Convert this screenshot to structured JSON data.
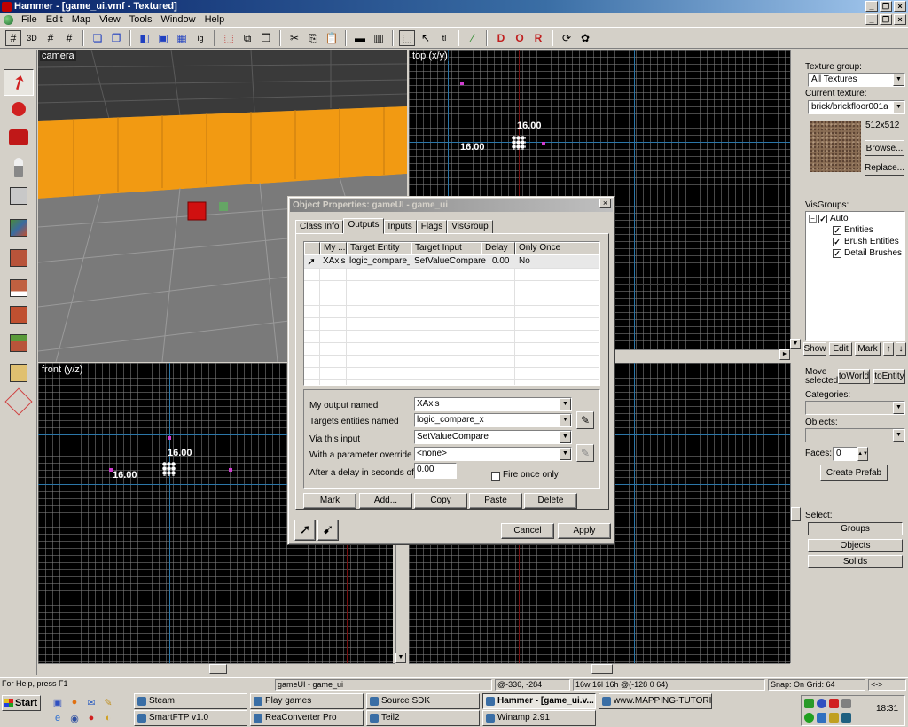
{
  "window": {
    "title": "Hammer - [game_ui.vmf - Textured]"
  },
  "menu": [
    "File",
    "Edit",
    "Map",
    "View",
    "Tools",
    "Window",
    "Help"
  ],
  "toolbar": {
    "icons": [
      "grid-toggle-icon",
      "3d-grid-icon",
      "small-grid-icon",
      "large-grid-icon",
      "group-icon",
      "ungroup-icon",
      "carve-icon",
      "hide-icon",
      "texture-lock-icon",
      "cordon-icon",
      "cut-icon",
      "copy-icon",
      "paste-icon",
      "texture-bar-icon",
      "select-icon",
      "pointer-icon",
      "vertex-icon",
      "entity-icon",
      "decal-icon",
      "overlay-icon",
      "clip-icon",
      "run-map-icon",
      "options-icon"
    ]
  },
  "viewports": {
    "camera": {
      "label": "camera"
    },
    "top": {
      "label": "top (x/y)",
      "dim_h": "16.00",
      "dim_v": "16.00"
    },
    "front": {
      "label": "front (y/z)",
      "dim_h": "16.00",
      "dim_v": "16.00"
    }
  },
  "right_panel": {
    "texture_group_label": "Texture group:",
    "texture_group_value": "All Textures",
    "current_texture_label": "Current texture:",
    "current_texture_value": "brick/brickfloor001a",
    "texture_size": "512x512",
    "browse": "Browse...",
    "replace": "Replace...",
    "visgroups_label": "VisGroups:",
    "visgroups": [
      {
        "label": "Auto",
        "checked": "✓"
      },
      {
        "label": "Entities",
        "checked": "✓"
      },
      {
        "label": "Brush Entities",
        "checked": "✓"
      },
      {
        "label": "Detail Brushes",
        "checked": "✓"
      }
    ],
    "show": "Show",
    "edit": "Edit",
    "mark": "Mark",
    "up_arrow": "↑",
    "down_arrow": "↓",
    "move_selected_label": "Move selected:",
    "to_world": "toWorld",
    "to_entity": "toEntity",
    "categories_label": "Categories:",
    "objects_label": "Objects:",
    "faces_label": "Faces:",
    "faces_value": "0",
    "create_prefab": "Create Prefab",
    "select_label": "Select:",
    "groups": "Groups",
    "objects": "Objects",
    "solids": "Solids"
  },
  "dialog": {
    "title": "Object Properties: gameUI - game_ui",
    "tabs": [
      "Class Info",
      "Outputs",
      "Inputs",
      "Flags",
      "VisGroup"
    ],
    "selected_tab": "Outputs",
    "columns": [
      "My ...",
      "Target Entity",
      "Target Input",
      "Delay",
      "Only Once"
    ],
    "rows": [
      {
        "output": "XAxis",
        "target": "logic_compare_x",
        "input": "SetValueCompare",
        "delay": "0.00",
        "once": "No"
      }
    ],
    "fields": {
      "output_label": "My output named",
      "output_value": "XAxis",
      "target_label": "Targets entities named",
      "target_value": "logic_compare_x",
      "input_label": "Via this input",
      "input_value": "SetValueCompare",
      "param_label": "With a parameter override of",
      "param_value": "<none>",
      "delay_label": "After a delay in seconds of",
      "delay_value": "0.00",
      "fire_once_label": "Fire once only"
    },
    "buttons": {
      "mark": "Mark",
      "add": "Add...",
      "copy": "Copy",
      "paste": "Paste",
      "delete": "Delete",
      "cancel": "Cancel",
      "apply": "Apply"
    }
  },
  "status": {
    "help": "For Help, press F1",
    "selection": "gameUI - game_ui",
    "coords": "@-336, -284",
    "size": "16w 16l 16h @(-128 0 64)",
    "snap": "Snap: On Grid: 64",
    "nav": "<->"
  },
  "taskbar": {
    "start": "Start",
    "tasks_row1": [
      "Steam",
      "Play games",
      "Source SDK",
      "Hammer - [game_ui.v...",
      "www.MAPPING-TUTORIA..."
    ],
    "tasks_row2": [
      "SmartFTP v1.0",
      "ReaConverter Pro",
      "Teil2",
      "Winamp 2.91"
    ],
    "clock": "18:31"
  }
}
